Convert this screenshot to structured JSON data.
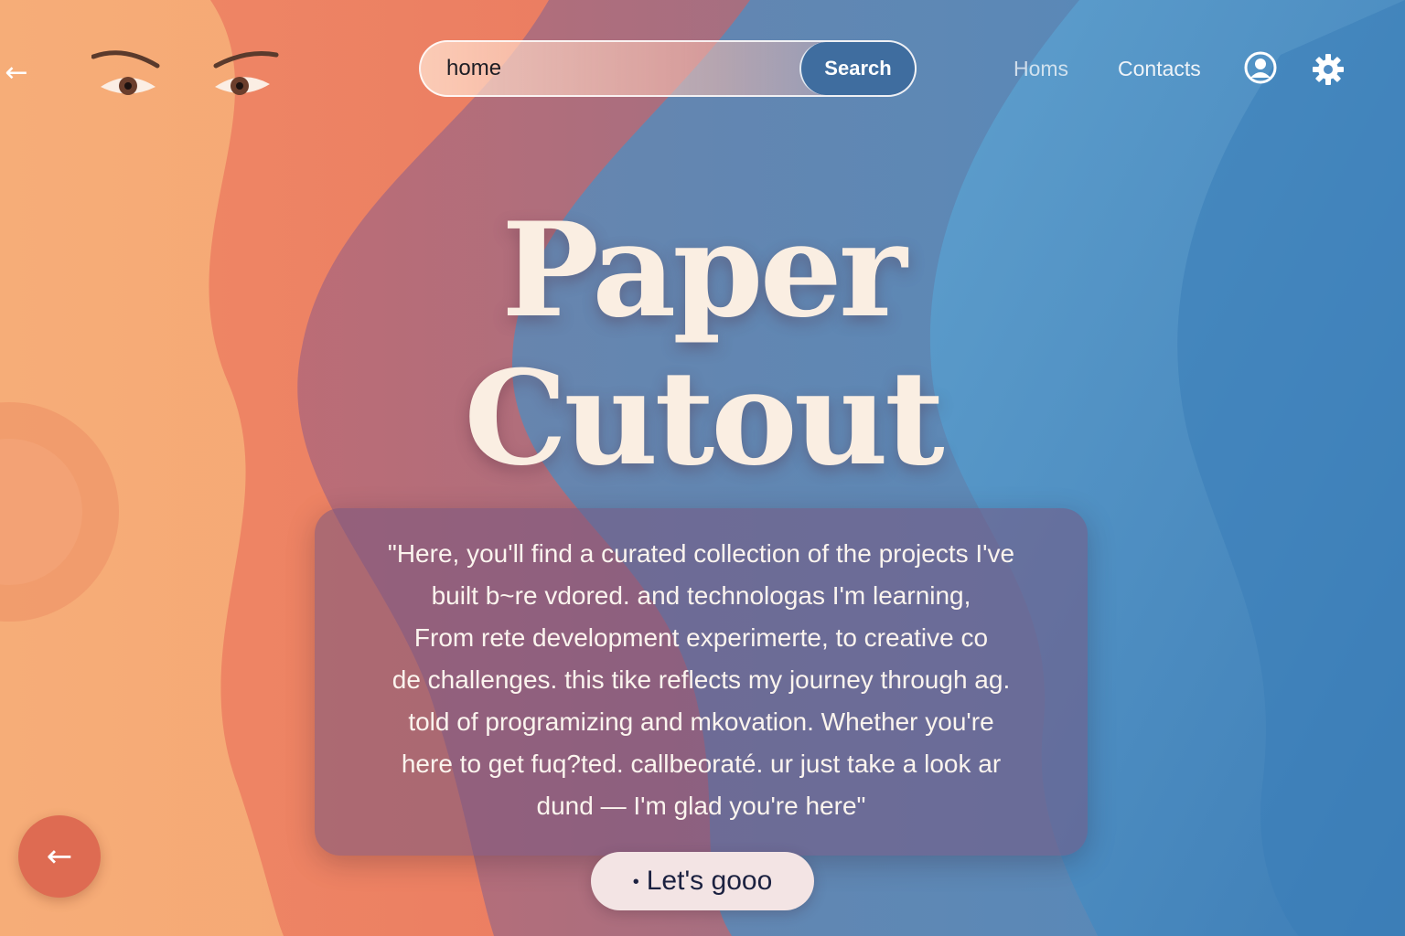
{
  "search": {
    "value": "home",
    "button_label": "Search"
  },
  "nav": {
    "home_label": "Homs",
    "contacts_label": "Contacts"
  },
  "hero": {
    "title_line1": "Paper",
    "title_line2": "Cutout"
  },
  "quote": {
    "lines": [
      "\"Here, you'll find a curated collection of the projects I've",
      "built  b~re vdored. and technologas I'm learning,",
      "From rete development experimerte, to creative co",
      "de challenges. this tike reflects my journey through ag.",
      "told of programizing and mkovation. Whether you're",
      "here to get fuq?ted. callbeoraté. ur just take a look ar",
      "dund — I'm glad you're here\""
    ]
  },
  "cta": {
    "label": "Let's gooo"
  },
  "icons": {
    "back_top": "arrow-left-icon",
    "back_bottom": "arrow-left-icon",
    "user": "user-circle-icon",
    "settings": "gear-icon"
  },
  "colors": {
    "search_button": "#3f6d9f",
    "title": "#faeee2",
    "cta_background": "#f3e4e4",
    "back_button": "#de6b52"
  }
}
